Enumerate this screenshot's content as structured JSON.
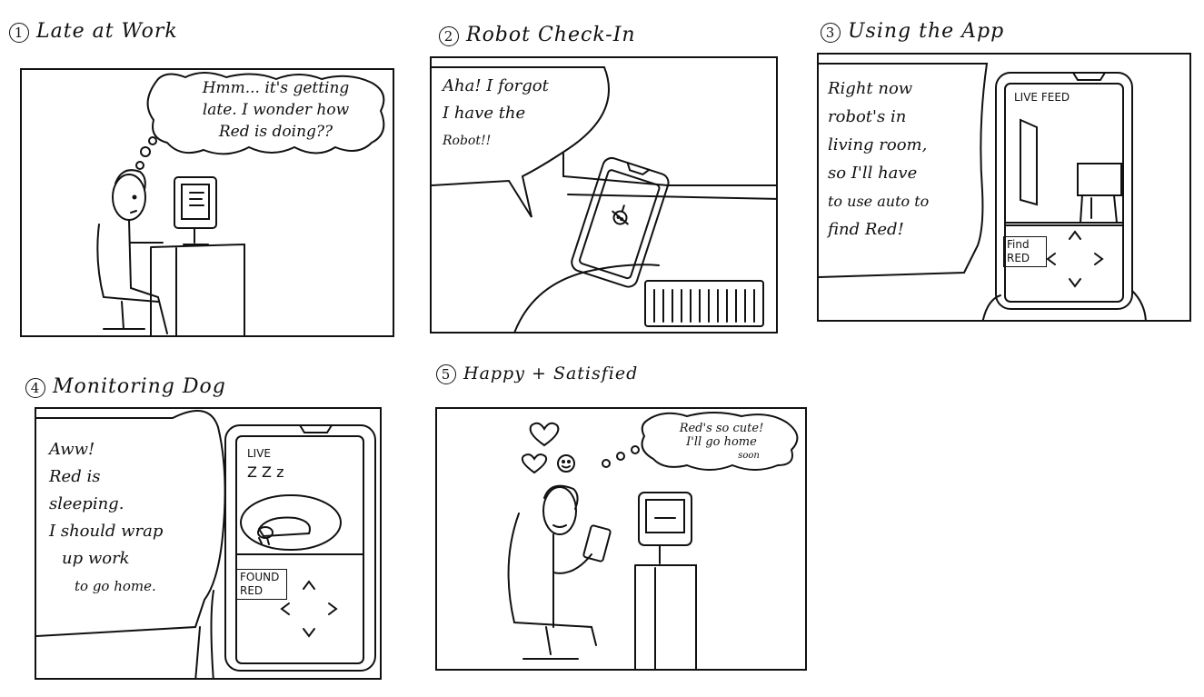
{
  "panels": [
    {
      "number": "1",
      "title": "Late at Work",
      "speech": [
        "Hmm... it's getting",
        "late. I wonder how",
        "Red is  doing??"
      ]
    },
    {
      "number": "2",
      "title": "Robot Check-In",
      "speech": [
        "Aha! I forgot",
        "I have the",
        "Robot!!"
      ]
    },
    {
      "number": "3",
      "title": "Using the App",
      "speech": [
        "Right now",
        "robot's in",
        "living room,",
        "so I'll have",
        "to use auto to",
        "find Red!"
      ],
      "phone_header": "LIVE FEED",
      "phone_button": [
        "Find",
        "RED"
      ]
    },
    {
      "number": "4",
      "title": "Monitoring Dog",
      "speech": [
        "Aww!",
        "Red is",
        "sleeping.",
        "I should wrap",
        "up work",
        "to go home."
      ],
      "phone_header": "LIVE",
      "phone_zzz": "Z Z z",
      "phone_button": [
        "FOUND",
        "RED"
      ]
    },
    {
      "number": "5",
      "title": "Happy + Satisfied",
      "speech": [
        "Red's so cute!",
        "I'll go home",
        "soon"
      ]
    }
  ],
  "icons": {
    "heart": "heart-icon",
    "smiley": "smiley-icon",
    "dpad": "dpad-icon",
    "dog": "dog-icon"
  }
}
